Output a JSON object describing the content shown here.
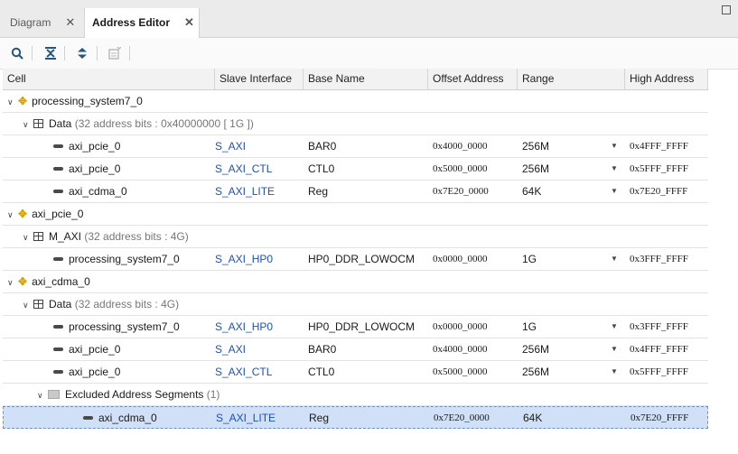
{
  "tabs": [
    {
      "label": "Diagram",
      "active": false
    },
    {
      "label": "Address Editor",
      "active": true
    }
  ],
  "toolbar": {
    "search_icon": "search-icon",
    "collapse_all_icon": "collapse-all-icon",
    "expand_all_icon": "expand-all-icon",
    "auto_assign_icon": "auto-assign-icon"
  },
  "columns": [
    "Cell",
    "Slave Interface",
    "Base Name",
    "Offset Address",
    "Range",
    "High Address"
  ],
  "rows": [
    {
      "type": "master",
      "indent": 0,
      "name": "processing_system7_0"
    },
    {
      "type": "space",
      "indent": 1,
      "name": "Data",
      "detail": "(32 address bits : 0x40000000 [ 1G ])"
    },
    {
      "type": "slave",
      "indent": 2,
      "name": "axi_pcie_0",
      "slave_if": "S_AXI",
      "base_name": "BAR0",
      "offset": "0x4000_0000",
      "range": "256M",
      "high": "0x4FFF_FFFF"
    },
    {
      "type": "slave",
      "indent": 2,
      "name": "axi_pcie_0",
      "slave_if": "S_AXI_CTL",
      "base_name": "CTL0",
      "offset": "0x5000_0000",
      "range": "256M",
      "high": "0x5FFF_FFFF"
    },
    {
      "type": "slave",
      "indent": 2,
      "name": "axi_cdma_0",
      "slave_if": "S_AXI_LITE",
      "base_name": "Reg",
      "offset": "0x7E20_0000",
      "range": "64K",
      "high": "0x7E20_FFFF"
    },
    {
      "type": "master",
      "indent": 0,
      "name": "axi_pcie_0"
    },
    {
      "type": "space",
      "indent": 1,
      "name": "M_AXI",
      "detail": "(32 address bits : 4G)"
    },
    {
      "type": "slave",
      "indent": 2,
      "name": "processing_system7_0",
      "slave_if": "S_AXI_HP0",
      "base_name": "HP0_DDR_LOWOCM",
      "offset": "0x0000_0000",
      "range": "1G",
      "high": "0x3FFF_FFFF"
    },
    {
      "type": "master",
      "indent": 0,
      "name": "axi_cdma_0"
    },
    {
      "type": "space",
      "indent": 1,
      "name": "Data",
      "detail": "(32 address bits : 4G)"
    },
    {
      "type": "slave",
      "indent": 2,
      "name": "processing_system7_0",
      "slave_if": "S_AXI_HP0",
      "base_name": "HP0_DDR_LOWOCM",
      "offset": "0x0000_0000",
      "range": "1G",
      "high": "0x3FFF_FFFF"
    },
    {
      "type": "slave",
      "indent": 2,
      "name": "axi_pcie_0",
      "slave_if": "S_AXI",
      "base_name": "BAR0",
      "offset": "0x4000_0000",
      "range": "256M",
      "high": "0x4FFF_FFFF"
    },
    {
      "type": "slave",
      "indent": 2,
      "name": "axi_pcie_0",
      "slave_if": "S_AXI_CTL",
      "base_name": "CTL0",
      "offset": "0x5000_0000",
      "range": "256M",
      "high": "0x5FFF_FFFF"
    },
    {
      "type": "folder",
      "indent": 2,
      "name": "Excluded Address Segments",
      "detail": "(1)"
    },
    {
      "type": "slave",
      "indent": 3,
      "name": "axi_cdma_0",
      "slave_if": "S_AXI_LITE",
      "base_name": "Reg",
      "offset": "0x7E20_0000",
      "range": "64K",
      "high": "0x7E20_FFFF",
      "selected": true,
      "no_dropdown": true
    }
  ]
}
